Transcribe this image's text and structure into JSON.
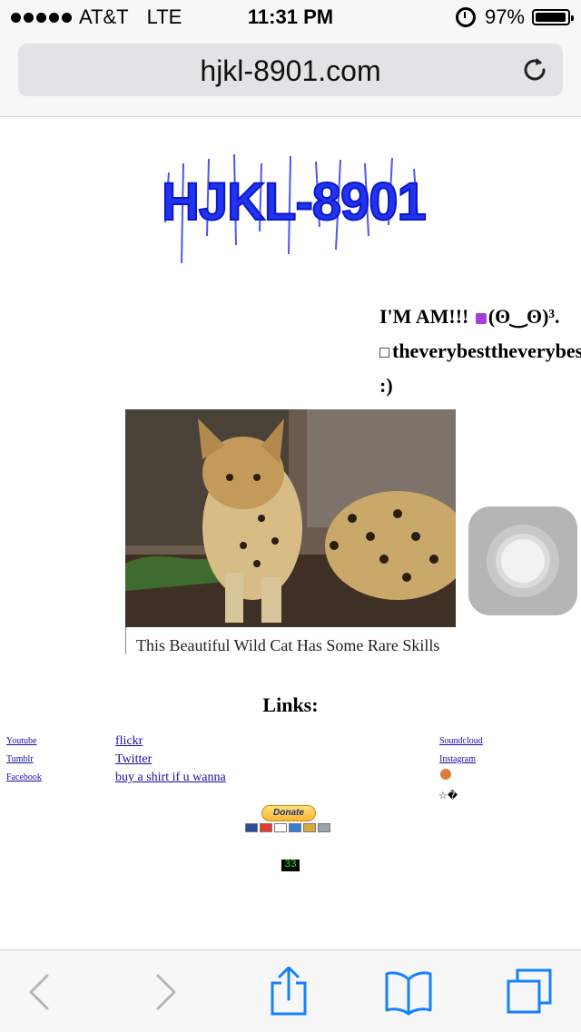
{
  "status_bar": {
    "carrier": "AT&T",
    "network": "LTE",
    "time": "11:31 PM",
    "battery": "97%",
    "battery_level": 0.97
  },
  "browser": {
    "url": "hjkl-8901.com"
  },
  "page": {
    "logo_text": "HJKL-8901",
    "headline": {
      "line1_text": "I'M AM!!! ",
      "line1_face": "(ʘ‿ʘ)³.",
      "line2": "theverybesttheverybest",
      "line3": ":)"
    },
    "ad": {
      "caption": "This Beautiful Wild Cat Has Some Rare Skills"
    },
    "links_title": "Links:",
    "links_col1": [
      "Youtube",
      "Tumblr",
      "Facebook"
    ],
    "links_col2": [
      "flickr",
      "Twitter",
      "buy a shirt if u wanna"
    ],
    "links_col3": [
      "Soundcloud",
      "Instagram"
    ],
    "star_text": "☆�",
    "donate_label": "Donate",
    "counter": "33"
  },
  "toolbar": {
    "icons": [
      "back-icon",
      "forward-icon",
      "share-icon",
      "bookmarks-icon",
      "tabs-icon"
    ]
  }
}
